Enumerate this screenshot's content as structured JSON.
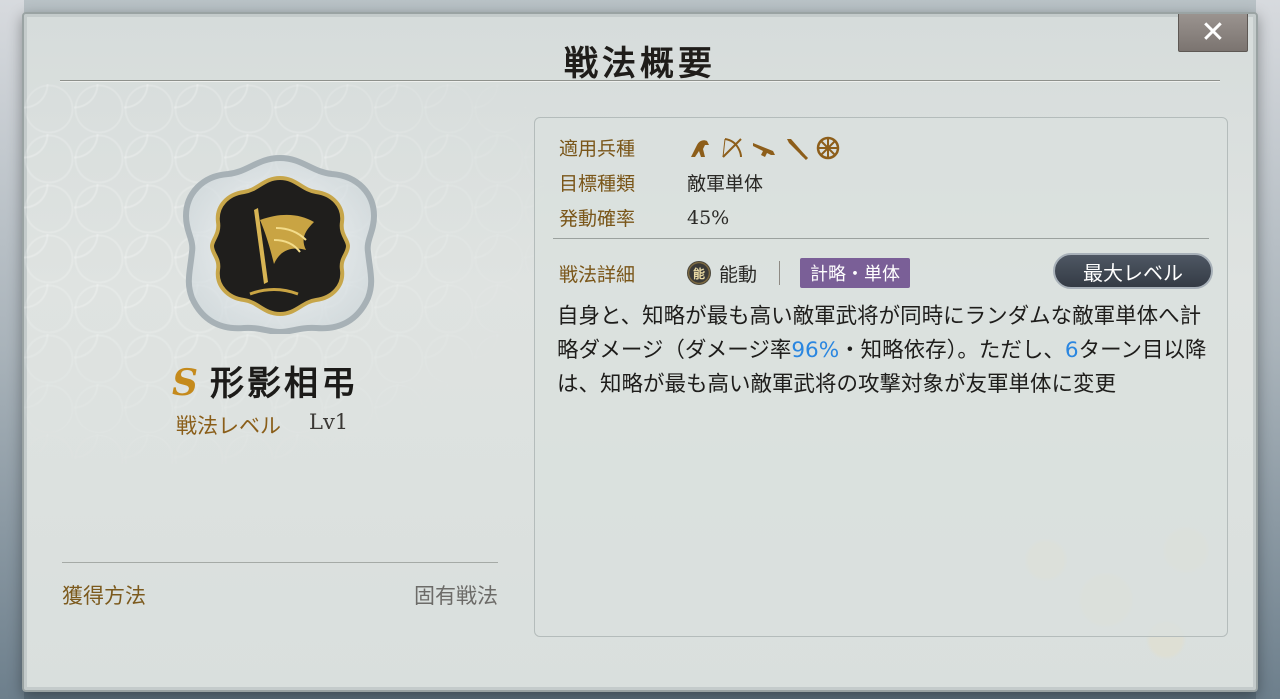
{
  "dialog": {
    "title": "戦法概要",
    "close_label": "✕"
  },
  "skill": {
    "rank": "S",
    "name": "形影相弔",
    "level_label": "戦法レベル",
    "level_value": "Lv1",
    "obtain_label": "獲得方法",
    "obtain_value": "固有戦法"
  },
  "attributes": {
    "troop_label": "適用兵種",
    "troop_icons": [
      "cavalry-icon",
      "archer-icon",
      "gun-icon",
      "spear-icon",
      "siege-wheel-icon"
    ],
    "target_label": "目標種類",
    "target_value": "敵軍単体",
    "rate_label": "発動確率",
    "rate_value": "45%"
  },
  "detail": {
    "label": "戦法詳細",
    "badge_char": "能",
    "activation": "能動",
    "type_tag": "計略・単体",
    "max_level_button": "最大レベル",
    "description_parts": {
      "p1": "自身と、知略が最も高い敵軍武将が同時にランダムな敵軍単体へ計略ダメージ（ダメージ率",
      "n1": "96%",
      "p2": "・知略依存）。ただし、",
      "n2": "6",
      "p3": "ターン目以降は、知略が最も高い敵軍武将の攻撃対象が友軍単体に変更"
    }
  },
  "colors": {
    "label_brown": "#7a5619",
    "highlight_blue": "#2a86e0",
    "tag_purple": "#7a5f97",
    "rank_gold": "#c58a1c"
  }
}
